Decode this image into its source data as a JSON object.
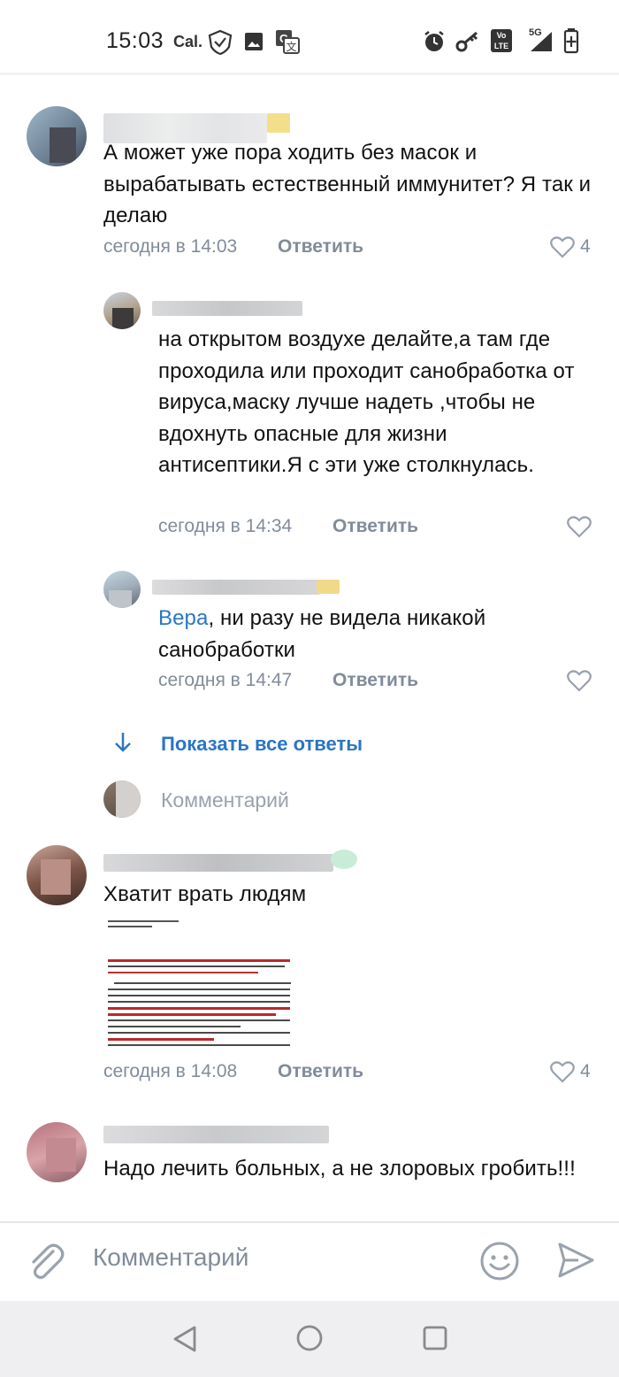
{
  "status_bar": {
    "time": "15:03",
    "carrier_label": "Cal.",
    "network": "5G",
    "volte": "Vo LTE",
    "icons": [
      "shield-check-icon",
      "image-icon",
      "translate-icon",
      "alarm-icon",
      "key-icon",
      "volte-icon",
      "signal-icon",
      "battery-icon"
    ]
  },
  "comments": [
    {
      "text": "А может уже пора ходить без масок и вырабатывать естественный иммунитет? Я так и делаю",
      "time": "сегодня в 14:03",
      "reply_label": "Ответить",
      "likes": "4"
    },
    {
      "text": "на открытом воздухе делайте,а там где проходила или проходит санобработка от вируса,маску лучше надеть ,чтобы не вдохнуть опасные для жизни антисептики.Я с эти уже столкнулась.",
      "time": "сегодня в 14:34",
      "reply_label": "Ответить"
    },
    {
      "mention": "Вера",
      "text": ", ни разу не видела никакой санобработки",
      "time": "сегодня в 14:47",
      "reply_label": "Ответить"
    },
    {
      "text": "Хватит врать людям",
      "time": "сегодня в 14:08",
      "reply_label": "Ответить",
      "likes": "4"
    },
    {
      "text": "Надо лечить больных, а не злоровых гробить!!!"
    }
  ],
  "show_all_replies": "Показать все ответы",
  "inline_comment_placeholder": "Комментарий",
  "input": {
    "placeholder": "Комментарий",
    "icons": [
      "attach-icon",
      "emoji-icon",
      "send-icon"
    ]
  },
  "nav": {
    "icons": [
      "back-icon",
      "home-icon",
      "recents-icon"
    ]
  },
  "colors": {
    "link": "#2a76c4",
    "meta": "#818c99",
    "like": "#99a2ad"
  }
}
